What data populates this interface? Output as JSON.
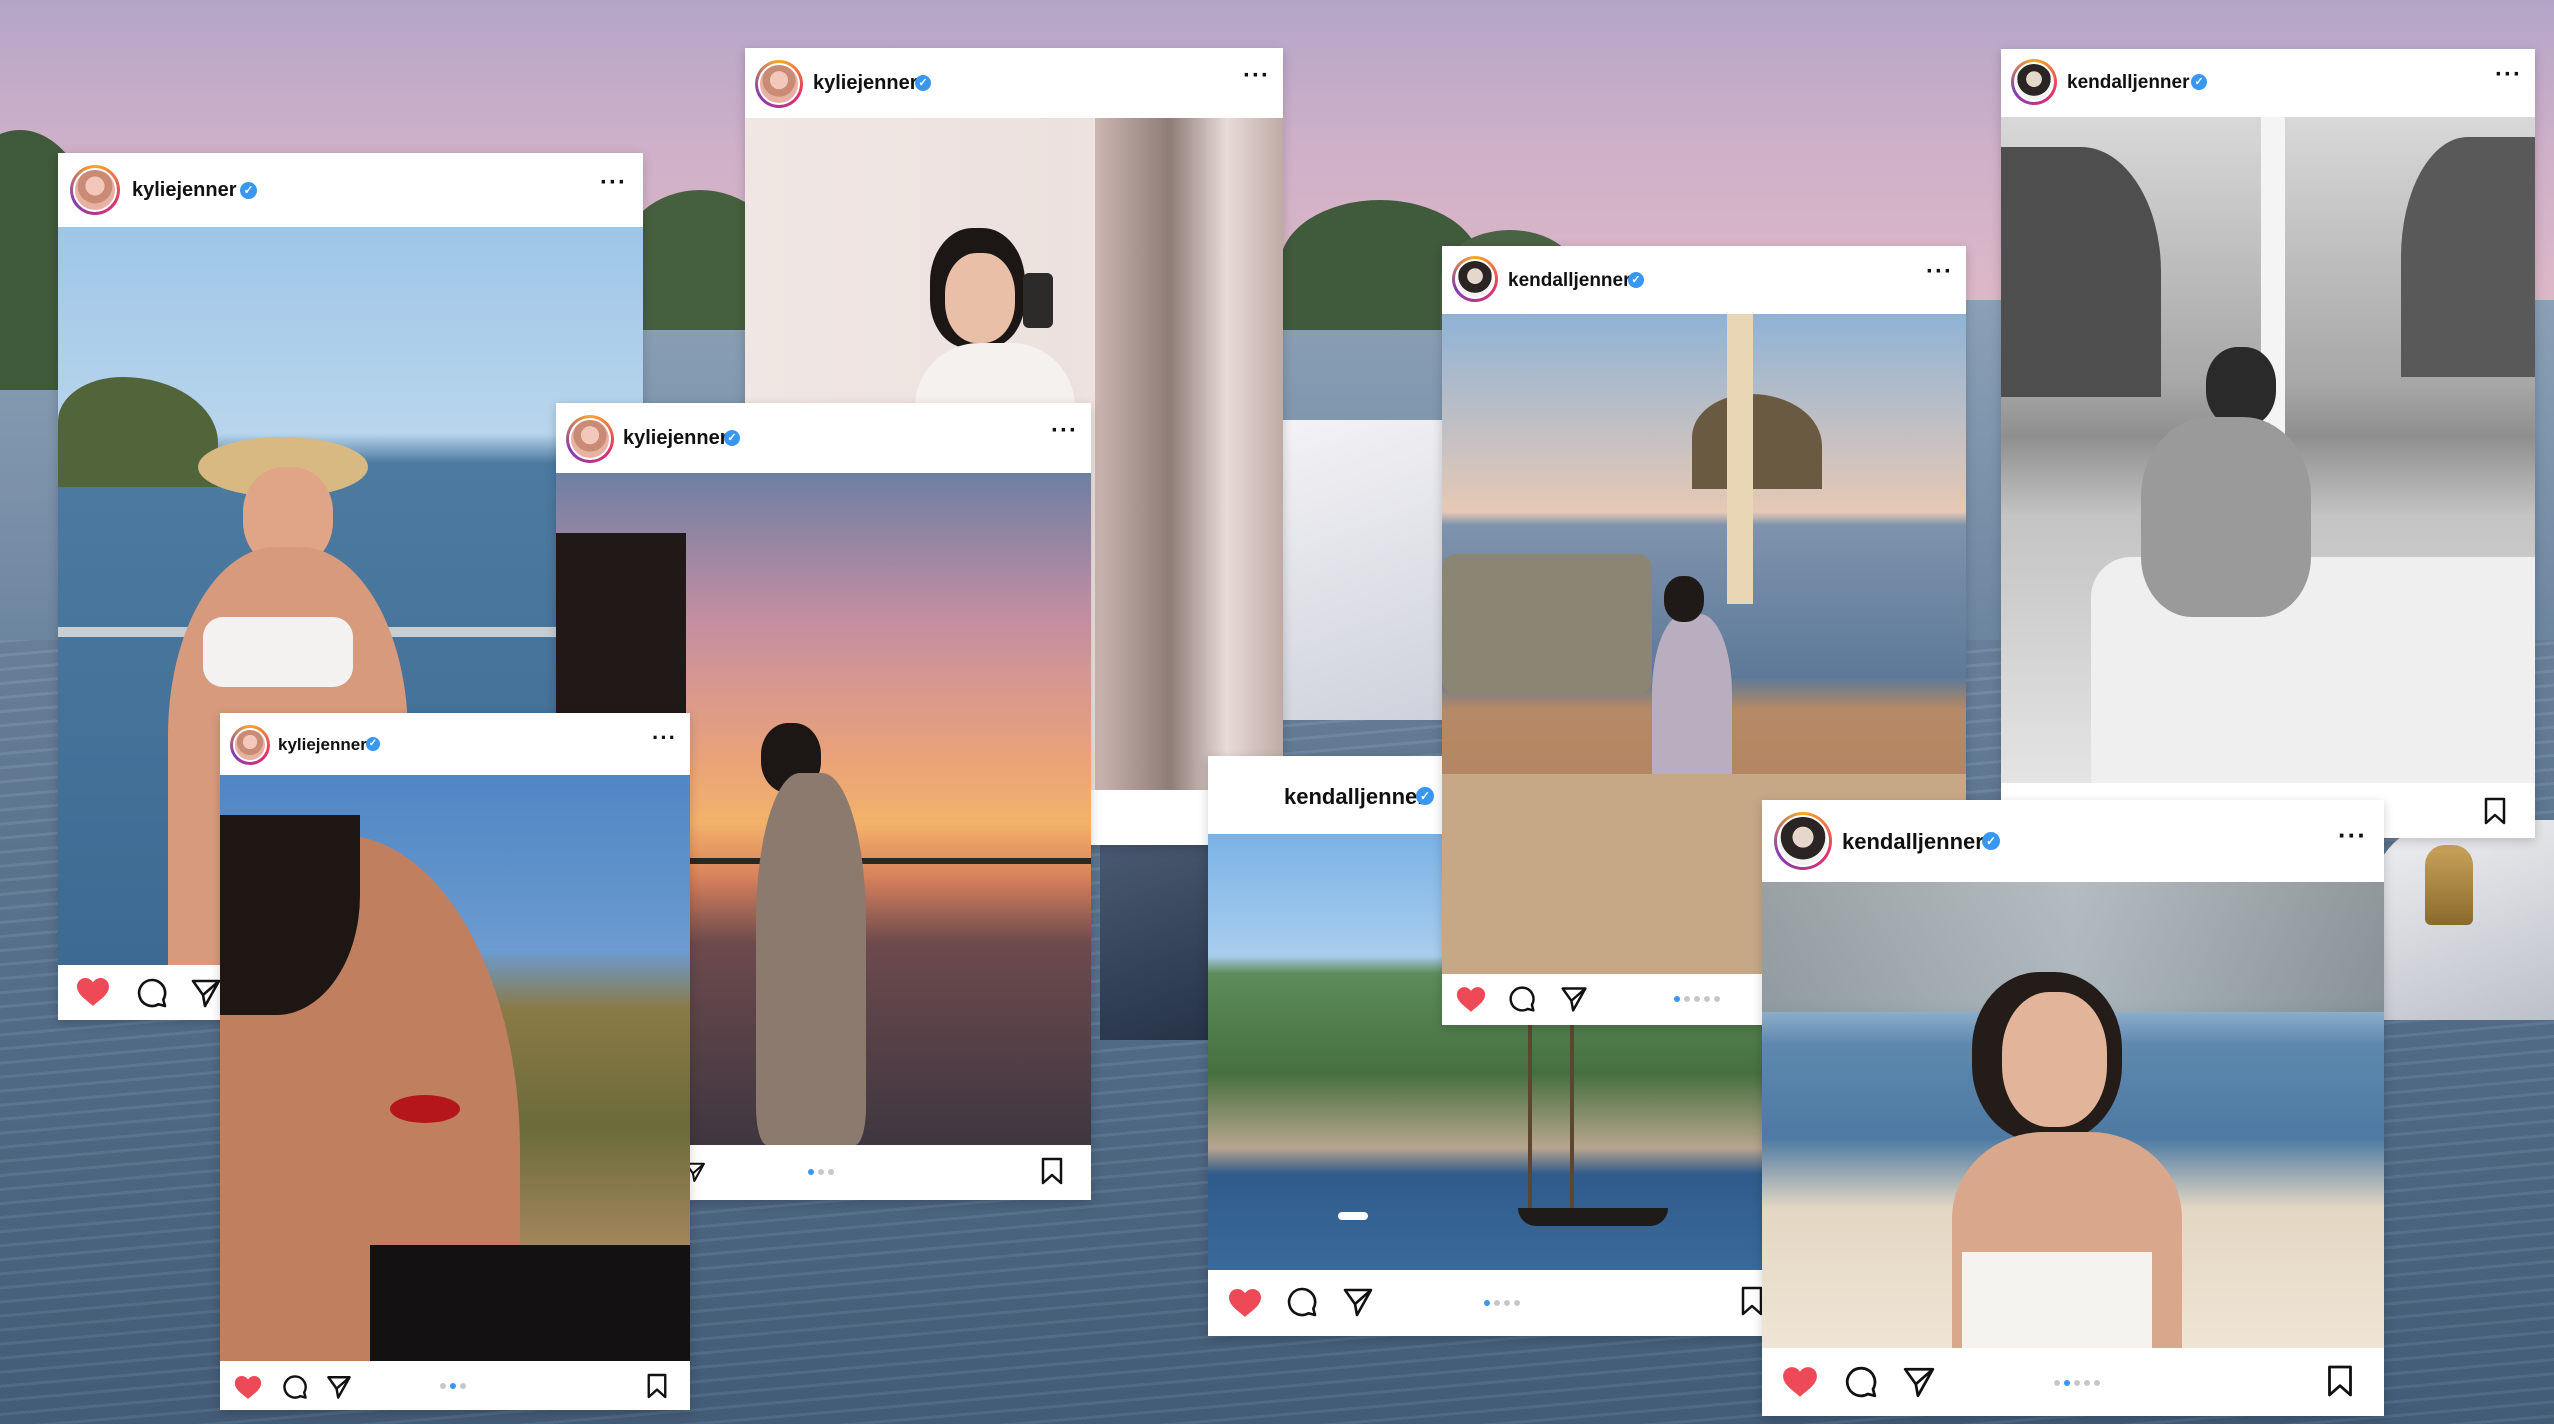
{
  "posts": [
    {
      "id": "p1",
      "username": "kyliejenner"
    },
    {
      "id": "p2",
      "username": "kyliejenner"
    },
    {
      "id": "p3",
      "username": "kyliejenner"
    },
    {
      "id": "p4",
      "username": "kyliejenner"
    },
    {
      "id": "p5",
      "username": "kendalljenner"
    },
    {
      "id": "p6",
      "username": "kendalljenner"
    },
    {
      "id": "p7",
      "username": "kendalljenner"
    },
    {
      "id": "p8",
      "username": "kendalljenner"
    }
  ],
  "icons": {
    "verified": "verified-badge-icon",
    "more": "more-options-icon",
    "like": "heart-icon",
    "comment": "comment-icon",
    "share": "share-icon",
    "save": "bookmark-icon"
  },
  "colors": {
    "like": "#ed4956",
    "carousel_active": "#3897f0",
    "verified": "#3897f0"
  }
}
